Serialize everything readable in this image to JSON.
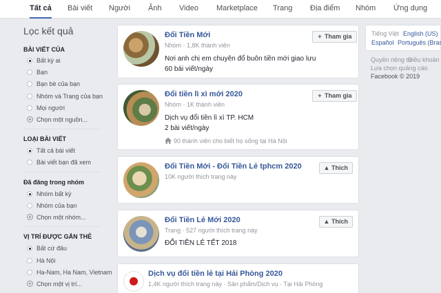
{
  "tabs": [
    "Tất cả",
    "Bài viết",
    "Người",
    "Ảnh",
    "Video",
    "Marketplace",
    "Trang",
    "Địa điểm",
    "Nhóm",
    "Ứng dụng"
  ],
  "filters": {
    "title": "Lọc kết quả",
    "sections": [
      {
        "heading": "BÀI VIẾT CỦA",
        "options": [
          "Bất kỳ ai",
          "Bạn",
          "Bạn bè của bạn",
          "Nhóm và Trang của bạn",
          "Mọi người"
        ],
        "selected": 0,
        "more": "Chọn một nguồn..."
      },
      {
        "heading": "LOẠI BÀI VIẾT",
        "options": [
          "Tất cả bài viết",
          "Bài viết bạn đã xem"
        ],
        "selected": 0,
        "more": ""
      },
      {
        "heading": "Đã đăng trong nhóm",
        "options": [
          "Nhóm bất kỳ",
          "Nhóm của bạn"
        ],
        "selected": 0,
        "more": "Chọn một nhóm..."
      },
      {
        "heading": "VỊ TRÍ ĐƯỢC GẮN THẺ",
        "options": [
          "Bất cứ đâu",
          "Hà Nội",
          "Ha-Nam, Ha Nam, Vietnam"
        ],
        "selected": 0,
        "more": "Chọn một vị trí..."
      }
    ]
  },
  "results": [
    {
      "title": "Đổi Tiền Mới",
      "meta": "Nhóm · 1,8K thành viên",
      "lines": [
        "Nơi anh chị em chuyên đổ buôn tiền mới giao lưu",
        "60 bài viết/ngày"
      ],
      "footer": "",
      "button": "Tham gia",
      "button_icon": "plus-icon"
    },
    {
      "title": "Đổi tiền lì xì mới 2020",
      "meta": "Nhóm · 1K thành viên",
      "lines": [
        "Dịch vụ đổi tiền lì xì TP. HCM",
        "2 bài viết/ngày"
      ],
      "footer": "90 thành viên cho biết họ sống tại Hà Nội",
      "button": "Tham gia",
      "button_icon": "plus-icon"
    },
    {
      "title": "Đổi Tiền Mới - Đổi Tiền Lẻ tphcm 2020",
      "meta": "10K người thích trang này",
      "lines": [],
      "footer": "",
      "button": "Thích",
      "button_icon": "like-icon"
    },
    {
      "title": "Đổi Tiền Lẻ Mới 2020",
      "meta": "Trang · 527 người thích trang này",
      "lines": [
        "ĐỔI TIỀN LẺ TẾT 2018"
      ],
      "footer": "",
      "button": "Thích",
      "button_icon": "like-icon"
    },
    {
      "title": "Dịch vụ đổi tiền lẻ tại Hải Phòng 2020",
      "meta": "1,4K người thích trang này · Sản phẩm/Dịch vụ · Tại Hải Phòng",
      "lines": [],
      "footer": "",
      "button": "",
      "button_icon": ""
    }
  ],
  "right": {
    "languages": [
      "Tiếng Việt",
      "English (US)",
      "Español",
      "Português (Brasil)"
    ],
    "footer_links": [
      "Quyền riêng tư",
      "Điều khoản",
      "Lựa chọn quảng cáo"
    ],
    "copyright": "Facebook © 2019"
  }
}
